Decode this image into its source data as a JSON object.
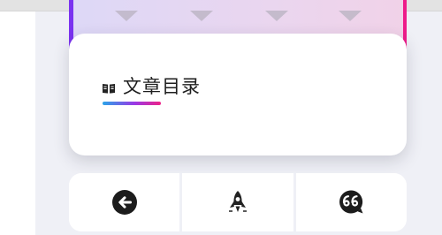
{
  "toc": {
    "title": "文章目录",
    "icon": "book-icon",
    "underline_gradient": [
      "#29a4e8",
      "#9a38e6",
      "#ee2287"
    ]
  },
  "banner": {
    "gradient": [
      "#ddd8f7",
      "#f1d2e8"
    ],
    "edge_left_color": "#7a32f0",
    "edge_right_color": "#ee1c8a"
  },
  "actions": [
    {
      "name": "back",
      "icon": "arrow-left-circle-icon"
    },
    {
      "name": "rocket",
      "icon": "rocket-icon"
    },
    {
      "name": "comments",
      "icon": "quote-bubble-icon"
    }
  ]
}
